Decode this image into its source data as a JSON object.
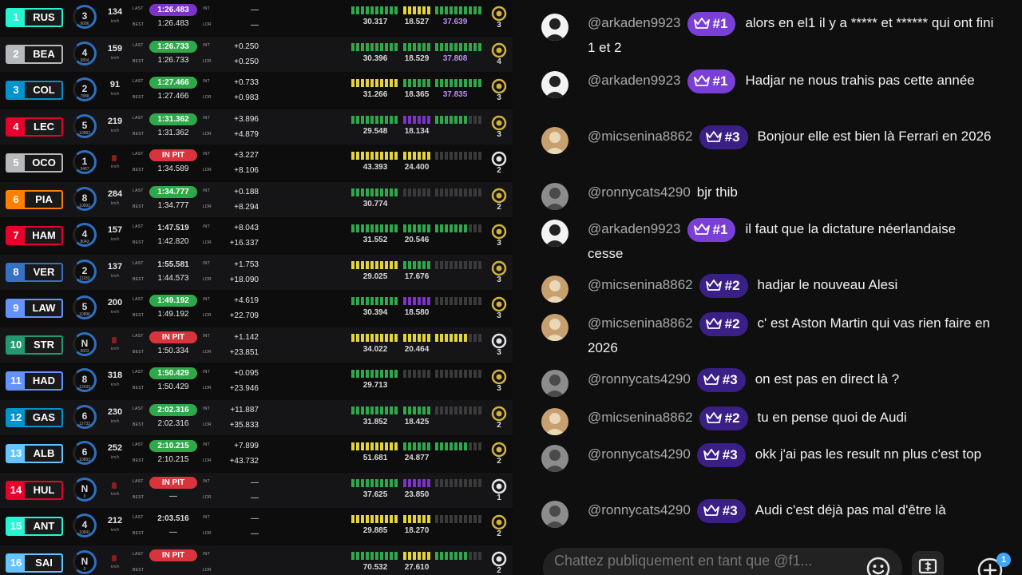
{
  "timing": {
    "labels": {
      "last": "LAST",
      "best": "BEST",
      "int": "INT",
      "lead": "LDR",
      "kmh": "km/h"
    },
    "rows": [
      {
        "pos": "1",
        "code": "RUS",
        "color": "#27f4d2",
        "tyre": "3",
        "tyre_laps": "9086",
        "speed": "134",
        "last": "1:26.483",
        "last_style": "purple",
        "best": "1:26.483",
        "int": "—",
        "lead": "—",
        "s1": "30.317",
        "s2": "18.527",
        "s3": "37.639",
        "medal": "3",
        "pit": false
      },
      {
        "pos": "2",
        "code": "BEA",
        "color": "#b6babd",
        "tyre": "4",
        "tyre_laps": "9804",
        "speed": "159",
        "last": "1:26.733",
        "last_style": "green",
        "best": "1:26.733",
        "int": "+0.250",
        "lead": "+0.250",
        "s1": "30.396",
        "s2": "18.529",
        "s3": "37.808",
        "medal": "4",
        "pit": false
      },
      {
        "pos": "3",
        "code": "COL",
        "color": "#0093cc",
        "tyre": "2",
        "tyre_laps": "7888",
        "speed": "91",
        "last": "1:27.466",
        "last_style": "green",
        "best": "1:27.466",
        "int": "+0.733",
        "lead": "+0.983",
        "s1": "31.266",
        "s2": "18.365",
        "s3": "37.835",
        "medal": "3",
        "pit": false
      },
      {
        "pos": "4",
        "code": "LEC",
        "color": "#e8002d",
        "tyre": "5",
        "tyre_laps": "10882",
        "speed": "219",
        "last": "1:31.362",
        "last_style": "green",
        "best": "1:31.362",
        "int": "+3.896",
        "lead": "+4.879",
        "s1": "29.548",
        "s2": "18.134",
        "s3": "",
        "medal": "3",
        "pit": false
      },
      {
        "pos": "5",
        "code": "OCO",
        "color": "#b6babd",
        "tyre": "1",
        "tyre_laps": "3467",
        "speed": "",
        "last": "IN PIT",
        "last_style": "pit",
        "best": "1:34.589",
        "int": "+3.227",
        "lead": "+8.106",
        "s1": "43.393",
        "s2": "24.400",
        "s3": "",
        "medal": "2",
        "pit": true
      },
      {
        "pos": "6",
        "code": "PIA",
        "color": "#ff8000",
        "tyre": "8",
        "tyre_laps": "10893",
        "speed": "284",
        "last": "1:34.777",
        "last_style": "green",
        "best": "1:34.777",
        "int": "+0.188",
        "lead": "+8.294",
        "s1": "30.774",
        "s2": "",
        "s3": "",
        "medal": "2",
        "pit": false
      },
      {
        "pos": "7",
        "code": "HAM",
        "color": "#e8002d",
        "tyre": "4",
        "tyre_laps": "8043",
        "speed": "157",
        "last": "1:47.519",
        "last_style": "white",
        "best": "1:42.820",
        "int": "+8.043",
        "lead": "+16.337",
        "s1": "31.552",
        "s2": "20.546",
        "s3": "",
        "medal": "3",
        "pit": false
      },
      {
        "pos": "8",
        "code": "VER",
        "color": "#3671c6",
        "tyre": "2",
        "tyre_laps": "11183",
        "speed": "137",
        "last": "1:55.581",
        "last_style": "white",
        "best": "1:44.573",
        "int": "+1.753",
        "lead": "+18.090",
        "s1": "29.025",
        "s2": "17.676",
        "s3": "",
        "medal": "3",
        "pit": false
      },
      {
        "pos": "9",
        "code": "LAW",
        "color": "#6692ff",
        "tyre": "5",
        "tyre_laps": "10896",
        "speed": "200",
        "last": "1:49.192",
        "last_style": "green",
        "best": "1:49.192",
        "int": "+4.619",
        "lead": "+22.709",
        "s1": "30.394",
        "s2": "18.580",
        "s3": "",
        "medal": "3",
        "pit": false
      },
      {
        "pos": "10",
        "code": "STR",
        "color": "#229971",
        "tyre": "N",
        "tyre_laps": "9663",
        "speed": "",
        "last": "IN PIT",
        "last_style": "pit",
        "best": "1:50.334",
        "int": "+1.142",
        "lead": "+23.851",
        "s1": "34.022",
        "s2": "20.464",
        "s3": "",
        "medal": "3",
        "pit": true
      },
      {
        "pos": "11",
        "code": "HAD",
        "color": "#6692ff",
        "tyre": "8",
        "tyre_laps": "13433",
        "speed": "318",
        "last": "1:50.429",
        "last_style": "green",
        "best": "1:50.429",
        "int": "+0.095",
        "lead": "+23.946",
        "s1": "29.713",
        "s2": "",
        "s3": "",
        "medal": "3",
        "pit": false
      },
      {
        "pos": "12",
        "code": "GAS",
        "color": "#0093cc",
        "tyre": "6",
        "tyre_laps": "12733",
        "speed": "230",
        "last": "2:02.316",
        "last_style": "green",
        "best": "2:02.316",
        "int": "+11.887",
        "lead": "+35.833",
        "s1": "31.852",
        "s2": "18.425",
        "s3": "",
        "medal": "2",
        "pit": false
      },
      {
        "pos": "13",
        "code": "ALB",
        "color": "#64c4ff",
        "tyre": "6",
        "tyre_laps": "10893",
        "speed": "252",
        "last": "2:10.215",
        "last_style": "green",
        "best": "2:10.215",
        "int": "+7.899",
        "lead": "+43.732",
        "s1": "51.681",
        "s2": "24.877",
        "s3": "",
        "medal": "2",
        "pit": false
      },
      {
        "pos": "14",
        "code": "HUL",
        "color": "#e8002d",
        "tyre": "N",
        "tyre_laps": "0",
        "speed": "",
        "last": "IN PIT",
        "last_style": "pit",
        "best": "—",
        "int": "—",
        "lead": "—",
        "s1": "37.625",
        "s2": "23.850",
        "s3": "",
        "medal": "1",
        "pit": true
      },
      {
        "pos": "15",
        "code": "ANT",
        "color": "#27f4d2",
        "tyre": "4",
        "tyre_laps": "10841",
        "speed": "212",
        "last": "2:03.516",
        "last_style": "white",
        "best": "—",
        "int": "—",
        "lead": "—",
        "s1": "29.885",
        "s2": "18.270",
        "s3": "",
        "medal": "2",
        "pit": false
      },
      {
        "pos": "16",
        "code": "SAI",
        "color": "#64c4ff",
        "tyre": "N",
        "tyre_laps": "0",
        "speed": "",
        "last": "IN PIT",
        "last_style": "pit",
        "best": "",
        "int": "",
        "lead": "",
        "s1": "70.532",
        "s2": "27.610",
        "s3": "",
        "medal": "2",
        "pit": true
      }
    ]
  },
  "chat": {
    "messages": [
      {
        "author": "@arkaden9923",
        "badge": "#1",
        "badge_style": "hi",
        "text": "alors en el1 il y a ***** et ****** qui ont fini 1 et 2",
        "avatar": "a"
      },
      {
        "author": "@arkaden9923",
        "badge": "#1",
        "badge_style": "hi",
        "text": "Hadjar ne nous trahis pas cette année",
        "avatar": "a"
      },
      {
        "author": "@micsenina8862",
        "badge": "#3",
        "badge_style": "lo",
        "text": "Bonjour elle est bien là Ferrari en 2026",
        "avatar": "m"
      },
      {
        "author": "@ronnycats4290",
        "badge": "",
        "badge_style": "",
        "text": "bjr thib",
        "avatar": "r"
      },
      {
        "author": "@arkaden9923",
        "badge": "#1",
        "badge_style": "hi",
        "text": "il faut que la dictature néerlandaise cesse",
        "avatar": "a"
      },
      {
        "author": "@micsenina8862",
        "badge": "#2",
        "badge_style": "lo",
        "text": "hadjar le nouveau Alesi",
        "avatar": "m"
      },
      {
        "author": "@micsenina8862",
        "badge": "#2",
        "badge_style": "lo",
        "text": "c' est Aston Martin qui vas rien faire en 2026",
        "avatar": "m"
      },
      {
        "author": "@ronnycats4290",
        "badge": "#3",
        "badge_style": "lo",
        "text": "on est pas en direct là ?",
        "avatar": "r"
      },
      {
        "author": "@micsenina8862",
        "badge": "#2",
        "badge_style": "lo",
        "text": "tu en pense quoi de Audi",
        "avatar": "m"
      },
      {
        "author": "@ronnycats4290",
        "badge": "#3",
        "badge_style": "lo",
        "text": "okk j'ai pas les result nn plus c'est top",
        "avatar": "r"
      },
      {
        "author": "@ronnycats4290",
        "badge": "#3",
        "badge_style": "lo",
        "text": "Audi c'est déjà pas mal d'être là",
        "avatar": "r"
      }
    ],
    "composer": {
      "placeholder": "Chattez publiquement en tant que @f1..."
    },
    "notif_count": "1",
    "icons": {
      "emoji": "emoji-icon",
      "money": "dollar-icon",
      "plus": "add-icon"
    }
  }
}
